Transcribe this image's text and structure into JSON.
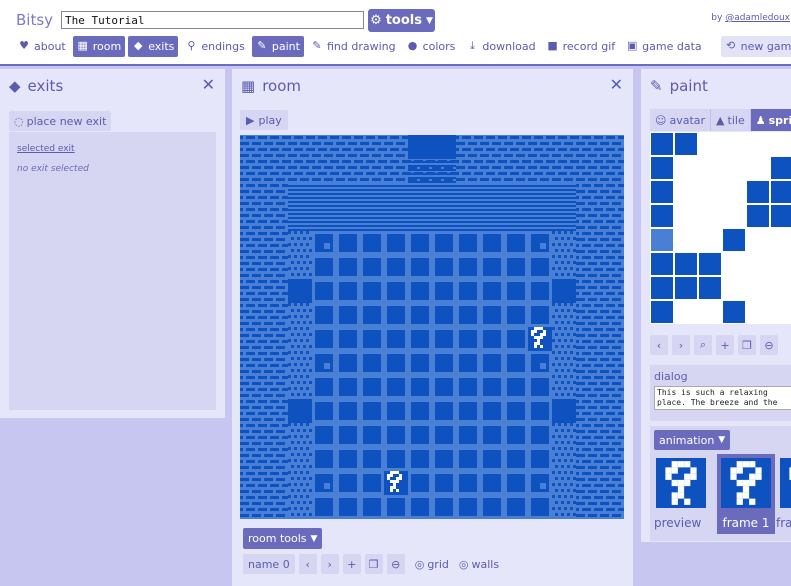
{
  "app": {
    "name": "Bitsy",
    "game_title": "The Tutorial",
    "tools_label": "tools",
    "byline_prefix": "by",
    "byline_author": "@adamledoux"
  },
  "nav": {
    "about": "about",
    "room": "room",
    "exits": "exits",
    "endings": "endings",
    "paint": "paint",
    "find_drawing": "find drawing",
    "colors": "colors",
    "download": "download",
    "record_gif": "record gif",
    "game_data": "game data",
    "new_game": "new game"
  },
  "exits_panel": {
    "title": "exits",
    "place_new_exit": "place new exit",
    "selected_exit": "selected exit",
    "no_exit": "no exit selected"
  },
  "room_panel": {
    "title": "room",
    "play": "play",
    "room_tools": "room tools",
    "name": "name 0",
    "grid": "grid",
    "walls": "walls"
  },
  "paint_panel": {
    "title": "paint",
    "tabs": {
      "avatar": "avatar",
      "tile": "tile",
      "sprite": "sprite"
    },
    "dialog_label": "dialog",
    "dialog_text": "This is such a relaxing\nplace. The breeze and the",
    "animation_label": "animation",
    "frames": {
      "preview": "preview",
      "frame1": "frame 1",
      "frame2": "fra"
    }
  },
  "colors": {
    "accent": "#6b6bbd",
    "room_bg": "#4a7fd6",
    "room_fg": "#0d52bf",
    "panel_bg": "#e6e6fa",
    "page_bg": "#c7c6f0"
  }
}
